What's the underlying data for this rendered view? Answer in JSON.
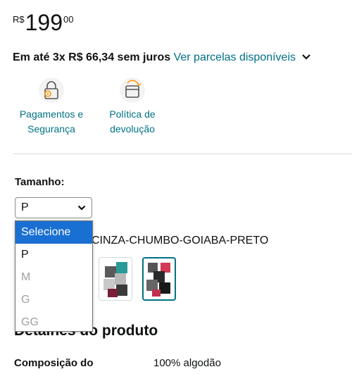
{
  "price": {
    "currency": "R$",
    "whole": "199",
    "fraction": "00"
  },
  "installments": {
    "text": "Em até 3x R$ 66,34 sem juros",
    "link": "Ver parcelas disponíveis"
  },
  "features": [
    {
      "line1": "Pagamentos e",
      "line2": "Segurança",
      "icon": "lock-icon"
    },
    {
      "line1": "Política de",
      "line2": "devolução",
      "icon": "return-box-icon"
    }
  ],
  "size": {
    "label": "Tamanho:",
    "selected": "P",
    "options": [
      {
        "label": "Selecione",
        "state": "highlighted"
      },
      {
        "label": "P",
        "state": "enabled"
      },
      {
        "label": "M",
        "state": "disabled"
      },
      {
        "label": "G",
        "state": "disabled"
      },
      {
        "label": "GG",
        "state": "disabled"
      }
    ]
  },
  "color": {
    "value": "CINZA-CHUMBO-GOIABA-PRETO"
  },
  "details": {
    "heading": "Detalhes do produto",
    "rows": [
      {
        "label": "Composição do",
        "value": "100% algodão"
      }
    ]
  },
  "colors": {
    "link": "#007185",
    "highlight": "#1a6fd2",
    "accent": "#ff9900"
  }
}
